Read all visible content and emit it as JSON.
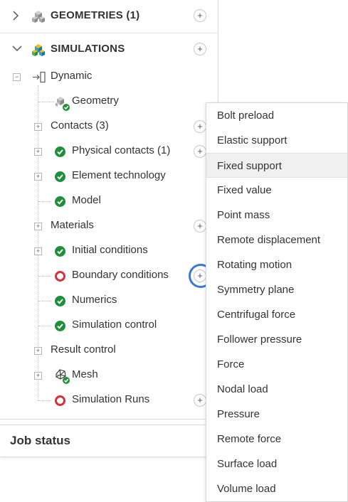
{
  "tree": {
    "geometries_title": "GEOMETRIES (1)",
    "simulations_title": "SIMULATIONS",
    "analysis_type": "Dynamic",
    "items": [
      {
        "label": "Geometry",
        "status": "geometry-ok"
      },
      {
        "label": "Contacts (3)",
        "status": "none"
      },
      {
        "label": "Physical contacts (1)",
        "status": "ok"
      },
      {
        "label": "Element technology",
        "status": "ok"
      },
      {
        "label": "Model",
        "status": "ok"
      },
      {
        "label": "Materials",
        "status": "none"
      },
      {
        "label": "Initial conditions",
        "status": "ok"
      },
      {
        "label": "Boundary conditions",
        "status": "error"
      },
      {
        "label": "Numerics",
        "status": "ok"
      },
      {
        "label": "Simulation control",
        "status": "ok"
      },
      {
        "label": "Result control",
        "status": "none"
      },
      {
        "label": "Mesh",
        "status": "mesh-ok"
      },
      {
        "label": "Simulation Runs",
        "status": "error"
      }
    ],
    "add_symbol": "+",
    "expand_symbol": "+",
    "collapse_symbol": "−"
  },
  "job_status": {
    "title": "Job status"
  },
  "boundary_menu": {
    "items": [
      "Bolt preload",
      "Elastic support",
      "Fixed support",
      "Fixed value",
      "Point mass",
      "Remote displacement",
      "Rotating motion",
      "Symmetry plane",
      "Centrifugal force",
      "Follower pressure",
      "Force",
      "Nodal load",
      "Pressure",
      "Remote force",
      "Surface load",
      "Volume load"
    ],
    "hovered_item": "Fixed support"
  },
  "colors": {
    "status_ok": "#1f8f3a",
    "status_error": "#d8303a",
    "highlight": "#3b78d8"
  }
}
